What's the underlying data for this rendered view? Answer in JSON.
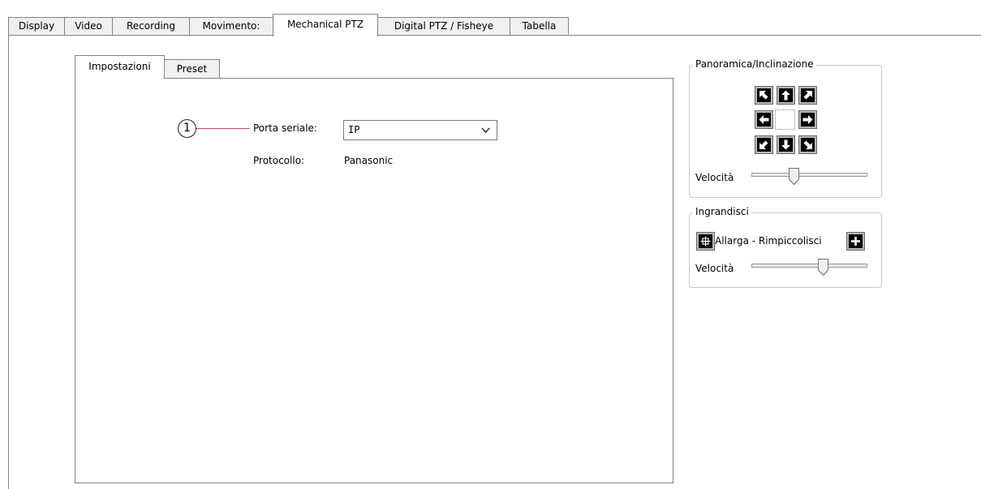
{
  "tabs": [
    {
      "label": "Display"
    },
    {
      "label": "Video"
    },
    {
      "label": "Recording"
    },
    {
      "label": "Movimento:"
    },
    {
      "label": "Mechanical PTZ",
      "active": true
    },
    {
      "label": "Digital PTZ / Fisheye"
    },
    {
      "label": "Tabella"
    }
  ],
  "inner_tabs": [
    {
      "label": "Impostazioni",
      "active": true
    },
    {
      "label": "Preset"
    }
  ],
  "settings": {
    "callout_number": "1",
    "serial_port_label": "Porta seriale:",
    "serial_port_value": "IP",
    "protocol_label": "Protocollo:",
    "protocol_value": "Panasonic"
  },
  "pan_tilt": {
    "title": "Panoramica/Inclinazione",
    "speed_label": "Velocità",
    "speed_level": 0.35
  },
  "zoom": {
    "title": "Ingrandisci",
    "zoom_label": "Allarga - Rimpiccolisci",
    "speed_label": "Velocità",
    "speed_level": 0.63
  },
  "colors": {
    "callout_line": "#d0457f",
    "button_bg": "#000000"
  },
  "icons": {
    "pan_up_left": "arrow-up-left-icon",
    "pan_up": "arrow-up-icon",
    "pan_up_right": "arrow-up-right-icon",
    "pan_left": "arrow-left-icon",
    "pan_right": "arrow-right-icon",
    "pan_down_left": "arrow-down-left-icon",
    "pan_down": "arrow-down-icon",
    "pan_down_right": "arrow-down-right-icon",
    "zoom_out": "zoom-wide-icon",
    "zoom_in": "plus-icon"
  }
}
